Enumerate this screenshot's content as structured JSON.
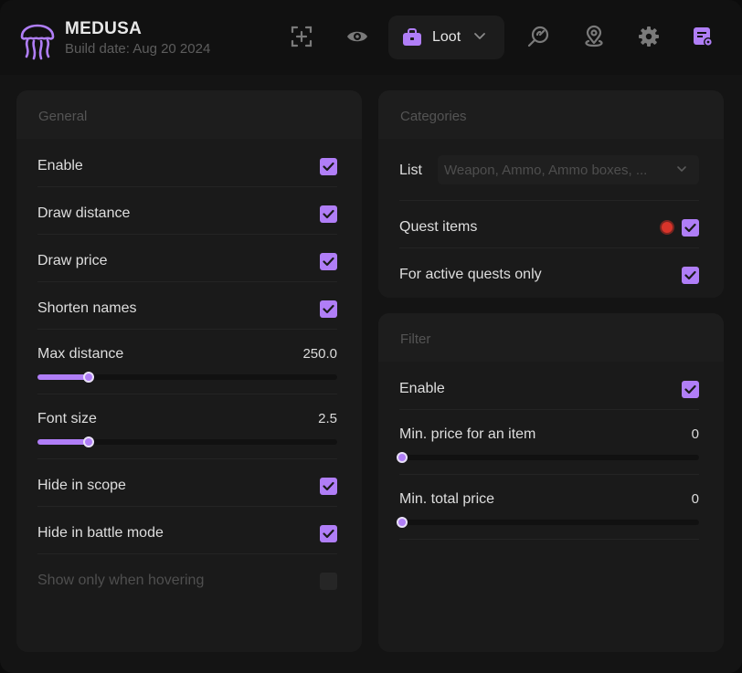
{
  "app": {
    "title": "MEDUSA",
    "build_date": "Build date: Aug 20 2024",
    "accent": "#b07ef7"
  },
  "nav": {
    "items": [
      {
        "name": "crosshair-icon",
        "active": false
      },
      {
        "name": "eye-icon",
        "active": false
      },
      {
        "name": "briefcase-icon",
        "active": true
      },
      {
        "name": "search-radar-icon",
        "active": false
      },
      {
        "name": "map-pin-icon",
        "active": false
      },
      {
        "name": "gear-icon",
        "active": false
      },
      {
        "name": "config-file-icon",
        "active": true
      }
    ],
    "current": "Loot"
  },
  "general": {
    "title": "General",
    "enable": {
      "label": "Enable",
      "checked": true
    },
    "draw_distance": {
      "label": "Draw distance",
      "checked": true
    },
    "draw_price": {
      "label": "Draw price",
      "checked": true
    },
    "shorten_names": {
      "label": "Shorten names",
      "checked": true
    },
    "max_distance": {
      "label": "Max distance",
      "value": "250.0",
      "fraction": 0.17
    },
    "font_size": {
      "label": "Font size",
      "value": "2.5",
      "fraction": 0.17
    },
    "hide_in_scope": {
      "label": "Hide in scope",
      "checked": true
    },
    "hide_in_battle": {
      "label": "Hide in battle mode",
      "checked": true
    },
    "show_hovering": {
      "label": "Show only when hovering",
      "checked": false,
      "disabled": true
    }
  },
  "categories": {
    "title": "Categories",
    "list_label": "List",
    "list_value": "Weapon, Ammo, Ammo boxes, ...",
    "quest_items": {
      "label": "Quest items",
      "checked": true,
      "color": "#d8342a"
    },
    "active_quests": {
      "label": "For active quests only",
      "checked": true
    }
  },
  "filter": {
    "title": "Filter",
    "enable": {
      "label": "Enable",
      "checked": true
    },
    "min_item_price": {
      "label": "Min. price for an item",
      "value": "0",
      "fraction": 0
    },
    "min_total_price": {
      "label": "Min. total price",
      "value": "0",
      "fraction": 0
    }
  }
}
